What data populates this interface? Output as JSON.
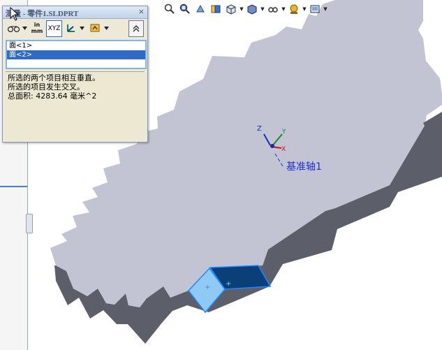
{
  "measure_panel": {
    "title": "测量 - 零件1.SLDPRT",
    "close_symbol": "×",
    "toolbar": {
      "units_label_top": "in",
      "units_label_bottom": "mm",
      "xyz_label": "XYZ"
    },
    "selections": [
      "面<1>",
      "面<2>"
    ],
    "results": [
      "所选的两个项目相互垂直。",
      "所选的项目发生交叉。",
      "总面积: 4283.64 毫米^2"
    ]
  },
  "viewport": {
    "axis_label": "基准轴1",
    "triad": {
      "x": "X",
      "y": "Y",
      "z": "Z"
    }
  },
  "colors": {
    "part_top": "#c2c4d3",
    "part_side": "#5c5f6a",
    "face_selected_dark": "#0b3f78",
    "face_selected_light": "#8ecaf5",
    "axis_label": "#1e2fd0"
  },
  "icons": {
    "hud": [
      "zoom-to-fit-icon",
      "zoom-to-area-icon",
      "previous-view-icon",
      "section-view-icon",
      "view-orientation-icon",
      "display-style-icon",
      "hide-show-items-icon",
      "appearance-icon",
      "scene-icon"
    ]
  }
}
